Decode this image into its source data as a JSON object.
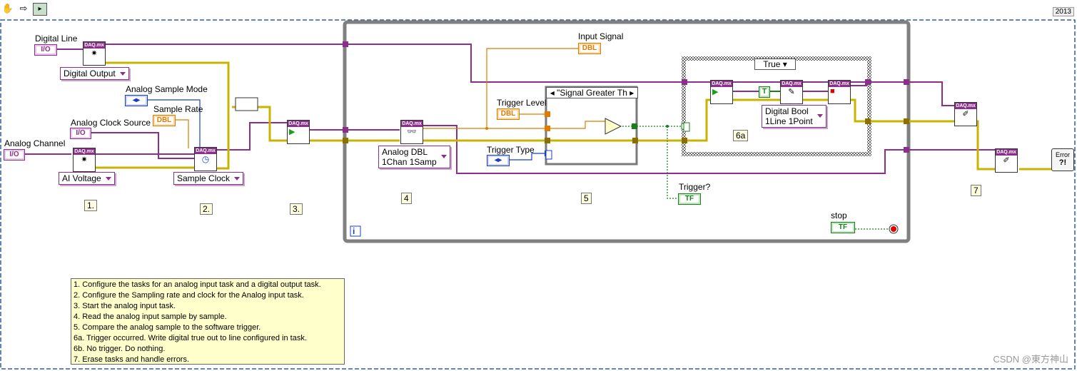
{
  "toolbar": {
    "hand_icon": "hand-icon",
    "arrow_icon": "arrow-icon",
    "vi_icon": "vi-icon"
  },
  "version": "2013",
  "labels": {
    "digital_line": "Digital Line",
    "analog_sample_mode": "Analog Sample Mode",
    "sample_rate": "Sample Rate",
    "analog_clock_source": "Analog Clock Source",
    "analog_channel": "Analog Channel",
    "input_signal": "Input Signal",
    "trigger_level": "Trigger Level",
    "trigger_type": "Trigger Type",
    "trigger": "Trigger?",
    "stop": "stop"
  },
  "terminals": {
    "io": "I/O",
    "dbl": "DBL",
    "tf": "TF",
    "daqmx": "DAQ.mx",
    "bool_true": "T"
  },
  "rings": {
    "digital_output": "Digital Output",
    "ai_voltage": "AI Voltage",
    "sample_clock": "Sample Clock",
    "analog_dbl_line1": "Analog DBL",
    "analog_dbl_line2": "1Chan 1Samp",
    "digital_bool_line1": "Digital Bool",
    "digital_bool_line2": "1Line 1Point"
  },
  "case_selectors": {
    "signal_greater": "\"Signal Greater Th",
    "true_case": "True"
  },
  "step_numbers": [
    "1.",
    "2.",
    "3.",
    "4",
    "5",
    "6a",
    "7"
  ],
  "loop_index": "i",
  "comment_lines": [
    "1. Configure the tasks for an analog input task and a digital output task.",
    "2. Configure the Sampling rate and clock for the Analog input task.",
    "3. Start the analog input task.",
    "4. Read the analog input sample by sample.",
    "5. Compare the analog sample to the software trigger.",
    "6a. Trigger occurred. Write digital true out to line configured in task.",
    "6b. No trigger. Do nothing.",
    "7.  Erase tasks and handle errors."
  ],
  "error_label": "Error",
  "watermark": "CSDN @東方神山",
  "colors": {
    "task_wire": "#8b2f8b",
    "error_wire": "#c8b400",
    "dbl_wire": "#e07b00",
    "bool_wire": "#1a7f1a",
    "enum_wire": "#1840c0",
    "loop_border": "#808080",
    "frame_border": "#2f5f9f"
  }
}
